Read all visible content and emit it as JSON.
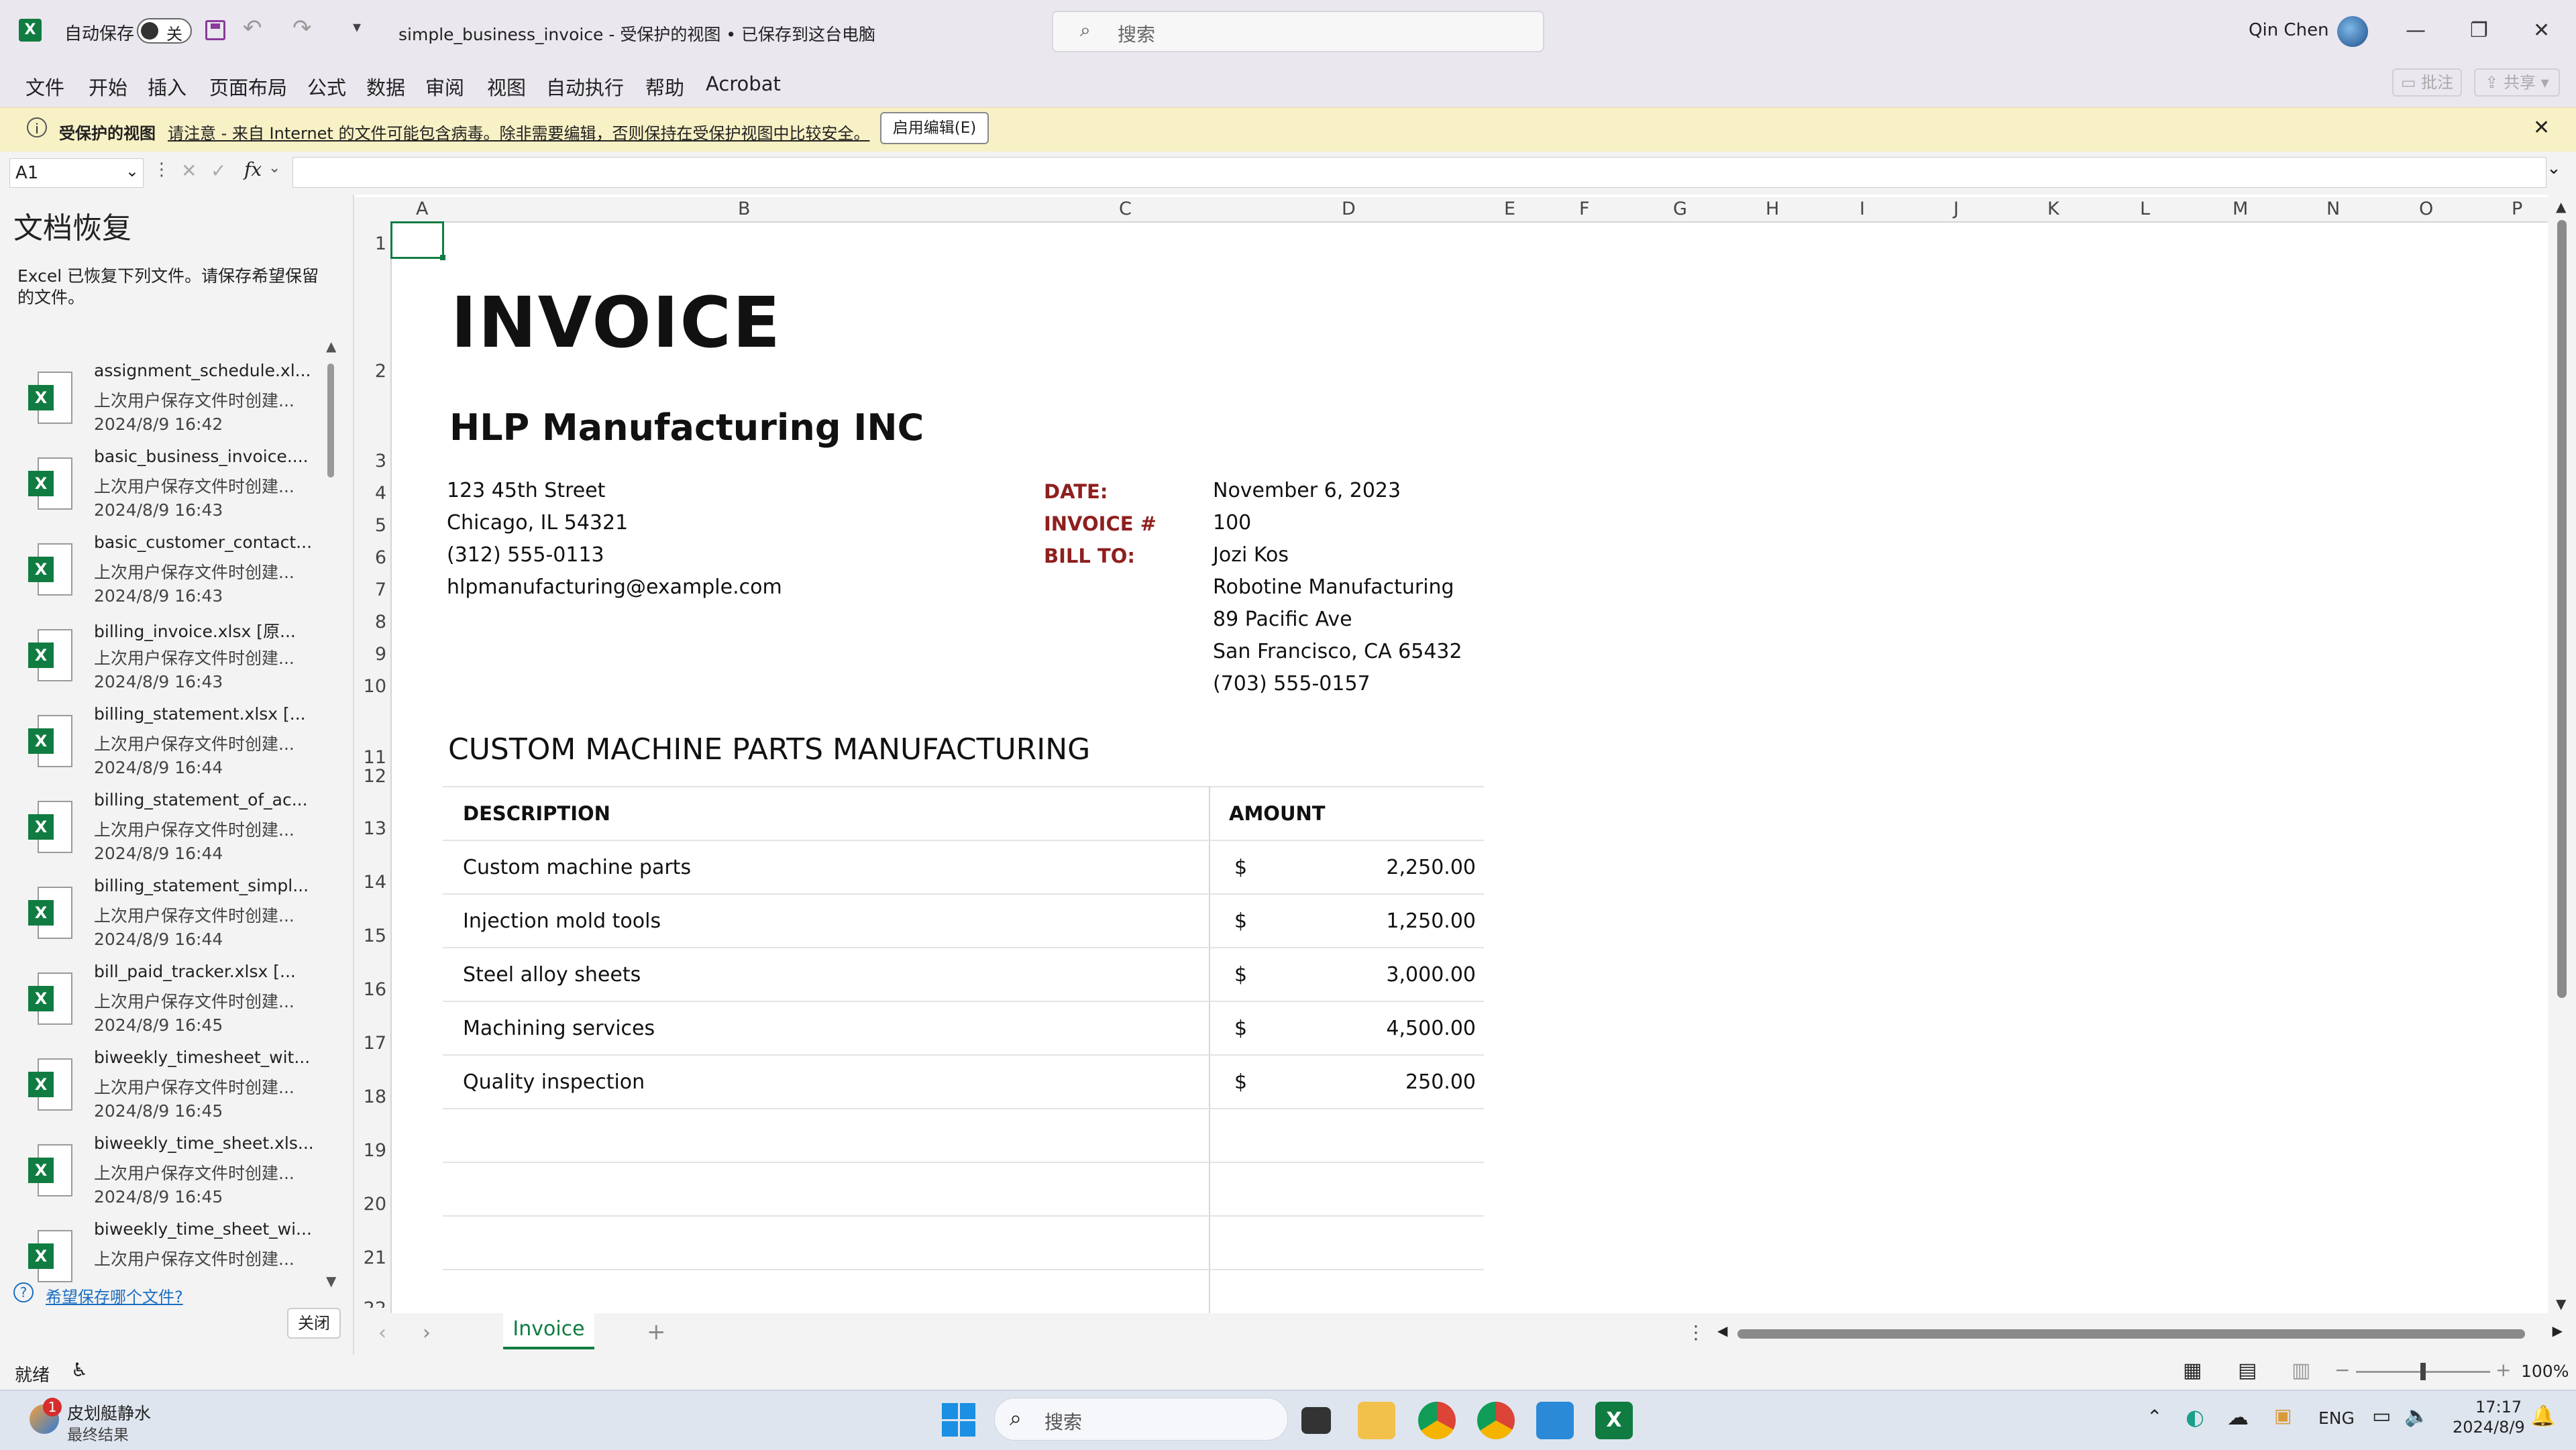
{
  "titlebar": {
    "autosave_label": "自动保存",
    "autosave_state": "关",
    "doc_title": "simple_business_invoice  -  受保护的视图 • 已保存到这台电脑",
    "search_placeholder": "搜索",
    "user_name": "Qin Chen"
  },
  "ribbon": {
    "tabs": [
      "文件",
      "开始",
      "插入",
      "页面布局",
      "公式",
      "数据",
      "审阅",
      "视图",
      "自动执行",
      "帮助",
      "Acrobat"
    ],
    "comment_label": "批注",
    "share_label": "共享"
  },
  "protected_bar": {
    "title": "受保护的视图",
    "message": "请注意 - 来自 Internet 的文件可能包含病毒。除非需要编辑，否则保持在受保护视图中比较安全。",
    "enable_button": "启用编辑(E)"
  },
  "formula_bar": {
    "name_box": "A1",
    "fx": "fx",
    "content": ""
  },
  "recovery": {
    "title": "文档恢复",
    "description": "Excel 已恢复下列文件。请保存希望保留的文件。",
    "items": [
      {
        "name": "assignment_schedule.xl...",
        "note": "上次用户保存文件时创建...",
        "time": "2024/8/9 16:42"
      },
      {
        "name": "basic_business_invoice....",
        "note": "上次用户保存文件时创建...",
        "time": "2024/8/9 16:43"
      },
      {
        "name": "basic_customer_contact...",
        "note": "上次用户保存文件时创建...",
        "time": "2024/8/9 16:43"
      },
      {
        "name": "billing_invoice.xlsx  [原...",
        "note": "上次用户保存文件时创建...",
        "time": "2024/8/9 16:43"
      },
      {
        "name": "billing_statement.xlsx  [...",
        "note": "上次用户保存文件时创建...",
        "time": "2024/8/9 16:44"
      },
      {
        "name": "billing_statement_of_ac...",
        "note": "上次用户保存文件时创建...",
        "time": "2024/8/9 16:44"
      },
      {
        "name": "billing_statement_simpl...",
        "note": "上次用户保存文件时创建...",
        "time": "2024/8/9 16:44"
      },
      {
        "name": "bill_paid_tracker.xlsx  [...",
        "note": "上次用户保存文件时创建...",
        "time": "2024/8/9 16:45"
      },
      {
        "name": "biweekly_timesheet_wit...",
        "note": "上次用户保存文件时创建...",
        "time": "2024/8/9 16:45"
      },
      {
        "name": "biweekly_time_sheet.xls...",
        "note": "上次用户保存文件时创建...",
        "time": "2024/8/9 16:45"
      },
      {
        "name": "biweekly_time_sheet_wi...",
        "note": "上次用户保存文件时创建...",
        "time": ""
      }
    ],
    "help_link": "希望保存哪个文件?",
    "close_button": "关闭"
  },
  "grid": {
    "columns": [
      "A",
      "B",
      "C",
      "D",
      "E",
      "F",
      "G",
      "H",
      "I",
      "J",
      "K",
      "L",
      "M",
      "N",
      "O",
      "P"
    ],
    "rows": [
      "1",
      "2",
      "3",
      "4",
      "5",
      "6",
      "7",
      "8",
      "9",
      "10",
      "11",
      "12",
      "13",
      "14",
      "15",
      "16",
      "17",
      "18",
      "19",
      "20",
      "21",
      "22"
    ]
  },
  "invoice": {
    "title": "INVOICE",
    "company": "HLP Manufacturing INC",
    "address1": "123 45th Street",
    "address2": "Chicago, IL 54321",
    "phone": "(312) 555-0113",
    "email": "hlpmanufacturing@example.com",
    "date_label": "DATE:",
    "date_value": "November 6, 2023",
    "invoice_label": "INVOICE #",
    "invoice_value": "100",
    "billto_label": "BILL TO:",
    "billto_lines": [
      "Jozi Kos",
      "Robotine Manufacturing",
      "89 Pacific Ave",
      "San Francisco, CA 65432",
      "(703) 555-0157"
    ],
    "section_title": "CUSTOM MACHINE PARTS MANUFACTURING",
    "desc_header": "DESCRIPTION",
    "amount_header": "AMOUNT",
    "currency": "$",
    "line_items": [
      {
        "description": "Custom machine parts",
        "amount": "2,250.00"
      },
      {
        "description": "Injection mold tools",
        "amount": "1,250.00"
      },
      {
        "description": "Steel alloy sheets",
        "amount": "3,000.00"
      },
      {
        "description": "Machining services",
        "amount": "4,500.00"
      },
      {
        "description": "Quality inspection",
        "amount": "250.00"
      }
    ]
  },
  "sheet_tabs": {
    "active": "Invoice"
  },
  "status": {
    "ready": "就绪",
    "zoom": "100%"
  },
  "taskbar": {
    "weather_title": "皮划艇静水",
    "weather_sub": "最终结果",
    "search_placeholder": "搜索",
    "lang": "ENG",
    "time": "17:17",
    "date": "2024/8/9"
  }
}
